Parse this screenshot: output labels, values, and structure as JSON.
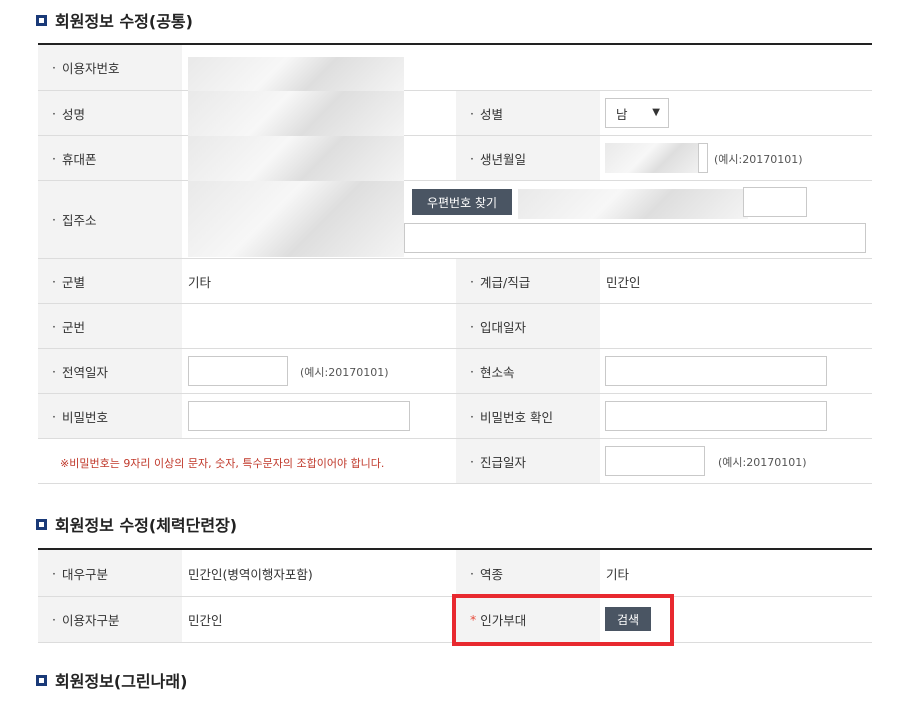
{
  "section1": {
    "title": "회원정보 수정(공통)",
    "rows": {
      "user_no_label": "이용자번호",
      "name_label": "성명",
      "gender_label": "성별",
      "gender_value": "남",
      "phone_label": "휴대폰",
      "birth_label": "생년월일",
      "birth_hint": "(예시:20170101)",
      "address_label": "집주소",
      "zip_button": "우편번호 찾기",
      "branch_label": "군별",
      "branch_value": "기타",
      "rank_label": "계급/직급",
      "rank_value": "민간인",
      "serial_label": "군번",
      "enlist_label": "입대일자",
      "discharge_label": "전역일자",
      "discharge_hint": "(예시:20170101)",
      "unit_label": "현소속",
      "password_label": "비밀번호",
      "password_confirm_label": "비밀번호 확인",
      "password_warning": "※비밀번호는 9자리 이상의 문자, 숫자, 특수문자의 조합이어야 합니다.",
      "promotion_label": "진급일자",
      "promotion_hint": "(예시:20170101)"
    }
  },
  "section2": {
    "title": "회원정보 수정(체력단련장)",
    "rows": {
      "treatment_label": "대우구분",
      "treatment_value": "민간인(병역이행자포함)",
      "service_label": "역종",
      "service_value": "기타",
      "user_type_label": "이용자구분",
      "user_type_value": "민간인",
      "approval_unit_label": "인가부대",
      "search_button": "검색"
    }
  },
  "section3": {
    "title": "회원정보(그린나래)"
  },
  "bullet": "·",
  "required_mark": "*",
  "colors": {
    "accent": "#1a3a78",
    "highlight": "#e8292f",
    "button": "#4a5563"
  }
}
